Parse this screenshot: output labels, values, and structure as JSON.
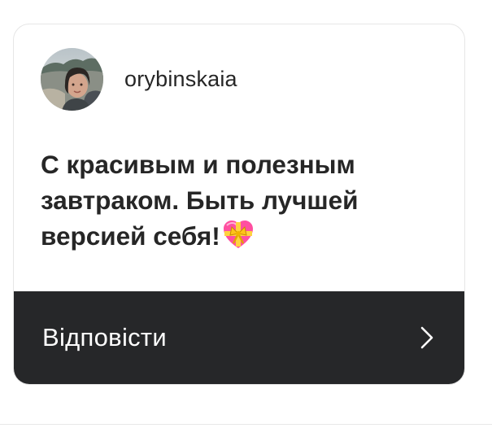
{
  "post": {
    "username": "orybinskaia",
    "avatar_icon": "profile-photo",
    "message": "С красивым и полезным завтраком. Быть лучшей версией себя!",
    "emoji_icon": "heart-with-ribbon-icon"
  },
  "reply": {
    "label": "Відповісти",
    "arrow_icon": "chevron-right-icon"
  },
  "colors": {
    "text": "#262626",
    "reply_bar_background": "#262729",
    "reply_bar_text": "#ffffff",
    "heart_pink": "#ff4fa0",
    "ribbon_yellow": "#ffd23f"
  }
}
